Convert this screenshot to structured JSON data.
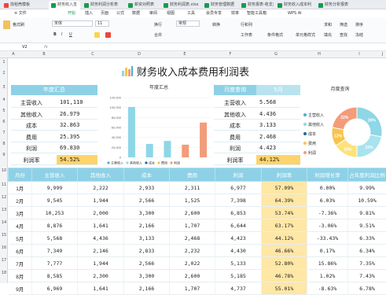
{
  "tabs": [
    {
      "label": "找稻壳模板",
      "color": "#e9473b"
    },
    {
      "label": "财务收入支",
      "color": "#1a9a4f"
    },
    {
      "label": "财务利润分析表",
      "color": "#1a9a4f"
    },
    {
      "label": "薪资对照表",
      "color": "#1a9a4f"
    },
    {
      "label": "财务利润表.xlsx",
      "color": "#1a9a4f"
    },
    {
      "label": "财务管理数据",
      "color": "#1a9a4f"
    },
    {
      "label": "财务报表-收支对",
      "color": "#1a9a4f"
    },
    {
      "label": "财务收入成本利",
      "color": "#1a9a4f"
    },
    {
      "label": "财务分析报表",
      "color": "#1a9a4f"
    }
  ],
  "menus": [
    "≡ 文件",
    "开始",
    "插入",
    "页面",
    "公式",
    "数据",
    "审阅",
    "视图",
    "工具",
    "会员专享",
    "效率",
    "智能工具箱",
    "WPS AI"
  ],
  "active_menu": "开始",
  "ribbon": {
    "paste": "格式刷",
    "font": "宋体",
    "size": "11",
    "wrap": "换行",
    "merge": "合并",
    "general": "常规",
    "convert": "转换",
    "rowcol": "行和列",
    "worksheet": "工作表",
    "condfmt": "条件格式",
    "cellstyle": "单元格样式",
    "sum": "求和",
    "filter": "筛选",
    "sort": "排序",
    "fill": "填充",
    "find": "查找",
    "freeze": "冻结"
  },
  "formula_bar": {
    "cell": "V2",
    "fx": "fx"
  },
  "columns": [
    "A",
    "B",
    "C",
    "D",
    "E",
    "F",
    "G",
    "H",
    "I",
    "J"
  ],
  "rows": [
    "1",
    "2",
    "3",
    "4",
    "5",
    "6",
    "7",
    "8",
    "9",
    "10",
    "11",
    "12",
    "13",
    "14",
    "15",
    "16",
    "17",
    "18"
  ],
  "title": "财务收入成本费用利润表",
  "summary": {
    "header": "年度汇总",
    "items": [
      {
        "label": "主营收入",
        "value": "101,110"
      },
      {
        "label": "其他收入",
        "value": "26.979"
      },
      {
        "label": "成本",
        "value": "32.863"
      },
      {
        "label": "费用",
        "value": "25.395"
      },
      {
        "label": "利润",
        "value": "69.830"
      },
      {
        "label": "利润率",
        "value": "54.52%"
      }
    ]
  },
  "monthly": {
    "header_label": "月度查询",
    "month": "5月",
    "items": [
      {
        "label": "主营收入",
        "value": "5.568"
      },
      {
        "label": "其他收入",
        "value": "4.436"
      },
      {
        "label": "成本",
        "value": "3.133"
      },
      {
        "label": "费用",
        "value": "2.468"
      },
      {
        "label": "利润",
        "value": "4.423"
      },
      {
        "label": "利润率",
        "value": "44.12%"
      }
    ]
  },
  "chart_data": [
    {
      "type": "bar",
      "title": "年度汇总",
      "categories": [
        "主营收入",
        "其他收入",
        "成本",
        "费用",
        "利润"
      ],
      "values": [
        101110,
        26979,
        32863,
        25395,
        69830
      ],
      "ylim": [
        0,
        120000
      ],
      "yticks": [
        "120,000",
        "100,000",
        "80,000",
        "60,000",
        "40,000",
        "20,000",
        "0"
      ],
      "colors": [
        "#8dd7e6",
        "#8dd7e6",
        "#8dd7e6",
        "#f39c7a",
        "#f39c7a"
      ],
      "legend": [
        "主营收入",
        "其他收入",
        "成本",
        "费用",
        "利润"
      ],
      "legend_colors": [
        "#4aaed0",
        "#8dd7e6",
        "#1b6e8a",
        "#f7c44d",
        "#f39c7a"
      ]
    },
    {
      "type": "pie",
      "title": "月度查询",
      "categories": [
        "主营收入",
        "其他收入",
        "成本",
        "费用",
        "利润"
      ],
      "values": [
        28,
        22,
        16,
        12,
        22
      ],
      "labels": [
        "28%",
        "22%",
        "16%",
        "12%",
        "22%"
      ],
      "colors": [
        "#8dd7e6",
        "#a8e3ee",
        "#fde17a",
        "#f7c44d",
        "#f39c7a"
      ],
      "legend_colors": [
        "#4aaed0",
        "#8dd7e6",
        "#1b6e8a",
        "#f7c44d",
        "#f39c7a"
      ]
    }
  ],
  "table": {
    "headers": [
      "月份",
      "主营收入",
      "其他收入",
      "成本",
      "费用",
      "利润",
      "利润率",
      "利润增长率",
      "占年度利润比例"
    ],
    "rows": [
      [
        "1月",
        "9,999",
        "2,222",
        "2,933",
        "2,311",
        "6,977",
        "57.09%",
        "0.00%",
        "9.99%"
      ],
      [
        "2月",
        "9,545",
        "1,944",
        "2,566",
        "1,525",
        "7,398",
        "64.39%",
        "6.03%",
        "10.59%"
      ],
      [
        "3月",
        "10,253",
        "2,000",
        "3,300",
        "2,600",
        "6,853",
        "53.74%",
        "-7.36%",
        "9.81%"
      ],
      [
        "4月",
        "8,876",
        "1,641",
        "2,166",
        "1,707",
        "6,644",
        "63.17%",
        "-3.06%",
        "9.51%"
      ],
      [
        "5月",
        "5,568",
        "4,436",
        "3,133",
        "2,468",
        "4,423",
        "44.12%",
        "-33.43%",
        "6.33%"
      ],
      [
        "6月",
        "7,349",
        "2,146",
        "2,833",
        "2,232",
        "4,430",
        "46.66%",
        "0.17%",
        "6.34%"
      ],
      [
        "7月",
        "7,777",
        "1,944",
        "2,566",
        "2,022",
        "5,133",
        "52.80%",
        "15.86%",
        "7.35%"
      ],
      [
        "8月",
        "8,585",
        "2,300",
        "3,300",
        "2,600",
        "5,185",
        "46.78%",
        "1.02%",
        "7.43%"
      ],
      [
        "9月",
        "6,969",
        "1,641",
        "2,166",
        "1,707",
        "4,737",
        "55.01%",
        "-8.63%",
        "6.78%"
      ]
    ]
  }
}
